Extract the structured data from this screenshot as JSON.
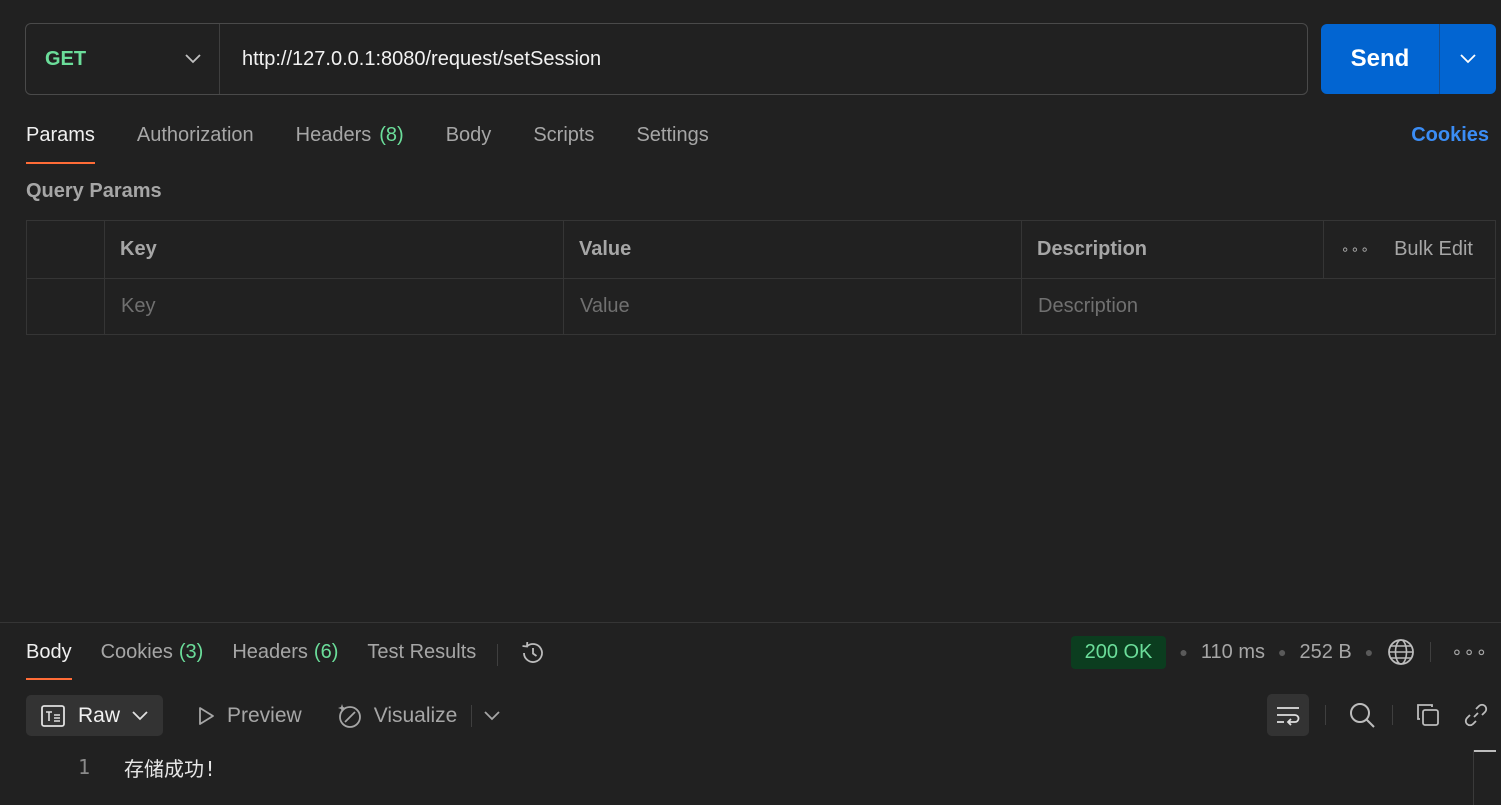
{
  "request": {
    "method": "GET",
    "url": "http://127.0.0.1:8080/request/setSession",
    "send_label": "Send"
  },
  "request_tabs": [
    {
      "label": "Params",
      "count": "",
      "active": true
    },
    {
      "label": "Authorization",
      "count": ""
    },
    {
      "label": "Headers",
      "count": "(8)"
    },
    {
      "label": "Body",
      "count": ""
    },
    {
      "label": "Scripts",
      "count": ""
    },
    {
      "label": "Settings",
      "count": ""
    }
  ],
  "cookies_link": "Cookies",
  "params": {
    "section_title": "Query Params",
    "headers": {
      "key": "Key",
      "value": "Value",
      "description": "Description",
      "bulk_edit": "Bulk Edit"
    },
    "placeholders": {
      "key": "Key",
      "value": "Value",
      "description": "Description"
    }
  },
  "response_tabs": [
    {
      "label": "Body",
      "count": "",
      "active": true
    },
    {
      "label": "Cookies",
      "count": "(3)"
    },
    {
      "label": "Headers",
      "count": "(6)"
    },
    {
      "label": "Test Results",
      "count": ""
    }
  ],
  "status": {
    "code": "200 OK",
    "time": "110 ms",
    "size": "252 B"
  },
  "view": {
    "raw": "Raw",
    "preview": "Preview",
    "visualize": "Visualize"
  },
  "body_lines": [
    {
      "no": "1",
      "text": "存储成功!"
    }
  ],
  "colors": {
    "accent": "#ff6c37",
    "send": "#0265d2",
    "method": "#6bdd9a",
    "link": "#3b8df5"
  },
  "icons": [
    "chevron-down-icon",
    "history-icon",
    "globe-icon",
    "more-icon",
    "raw-icon",
    "play-icon",
    "visualize-icon",
    "wrap-icon",
    "search-icon",
    "copy-icon",
    "link-icon"
  ]
}
